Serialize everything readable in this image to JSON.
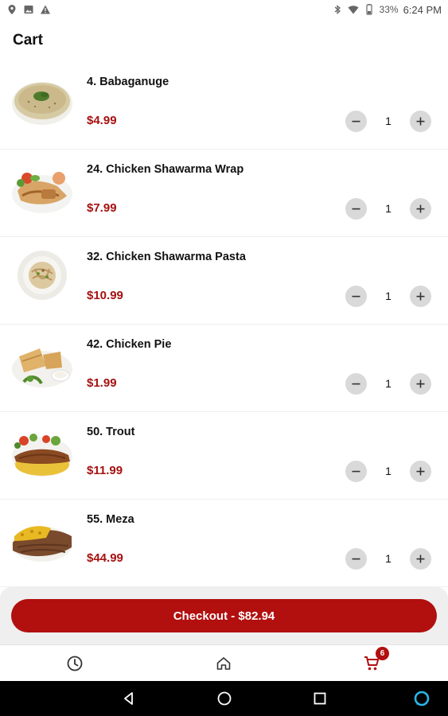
{
  "status_bar": {
    "left_icons": [
      "location-pin-icon",
      "image-icon",
      "warning-icon"
    ],
    "right_icons": [
      "bluetooth-icon",
      "wifi-icon",
      "battery-icon"
    ],
    "battery": "33%",
    "time": "6:24 PM"
  },
  "header": {
    "title": "Cart"
  },
  "cart": {
    "items": [
      {
        "name": "4. Babaganuge",
        "price": "$4.99",
        "quantity": "1",
        "image": "babaganuge-dish"
      },
      {
        "name": "24. Chicken Shawarma Wrap",
        "price": "$7.99",
        "quantity": "1",
        "image": "shawarma-wrap-dish"
      },
      {
        "name": "32. Chicken Shawarma Pasta",
        "price": "$10.99",
        "quantity": "1",
        "image": "shawarma-pasta-dish"
      },
      {
        "name": "42. Chicken Pie",
        "price": "$1.99",
        "quantity": "1",
        "image": "chicken-pie-dish"
      },
      {
        "name": "50. Trout",
        "price": "$11.99",
        "quantity": "1",
        "image": "trout-dish"
      },
      {
        "name": "55. Meza",
        "price": "$44.99",
        "quantity": "1",
        "image": "meza-dish"
      }
    ]
  },
  "checkout": {
    "label": "Checkout - $82.94"
  },
  "bottom_nav": {
    "tabs": [
      "history-icon",
      "home-icon",
      "cart-icon"
    ],
    "cart_badge": "6"
  },
  "system_nav": [
    "back-icon",
    "home-circle-icon",
    "recents-icon",
    "assistant-icon"
  ],
  "colors": {
    "accent": "#b20f0f",
    "price": "#a61111",
    "qty_button": "#d9d9d9"
  }
}
